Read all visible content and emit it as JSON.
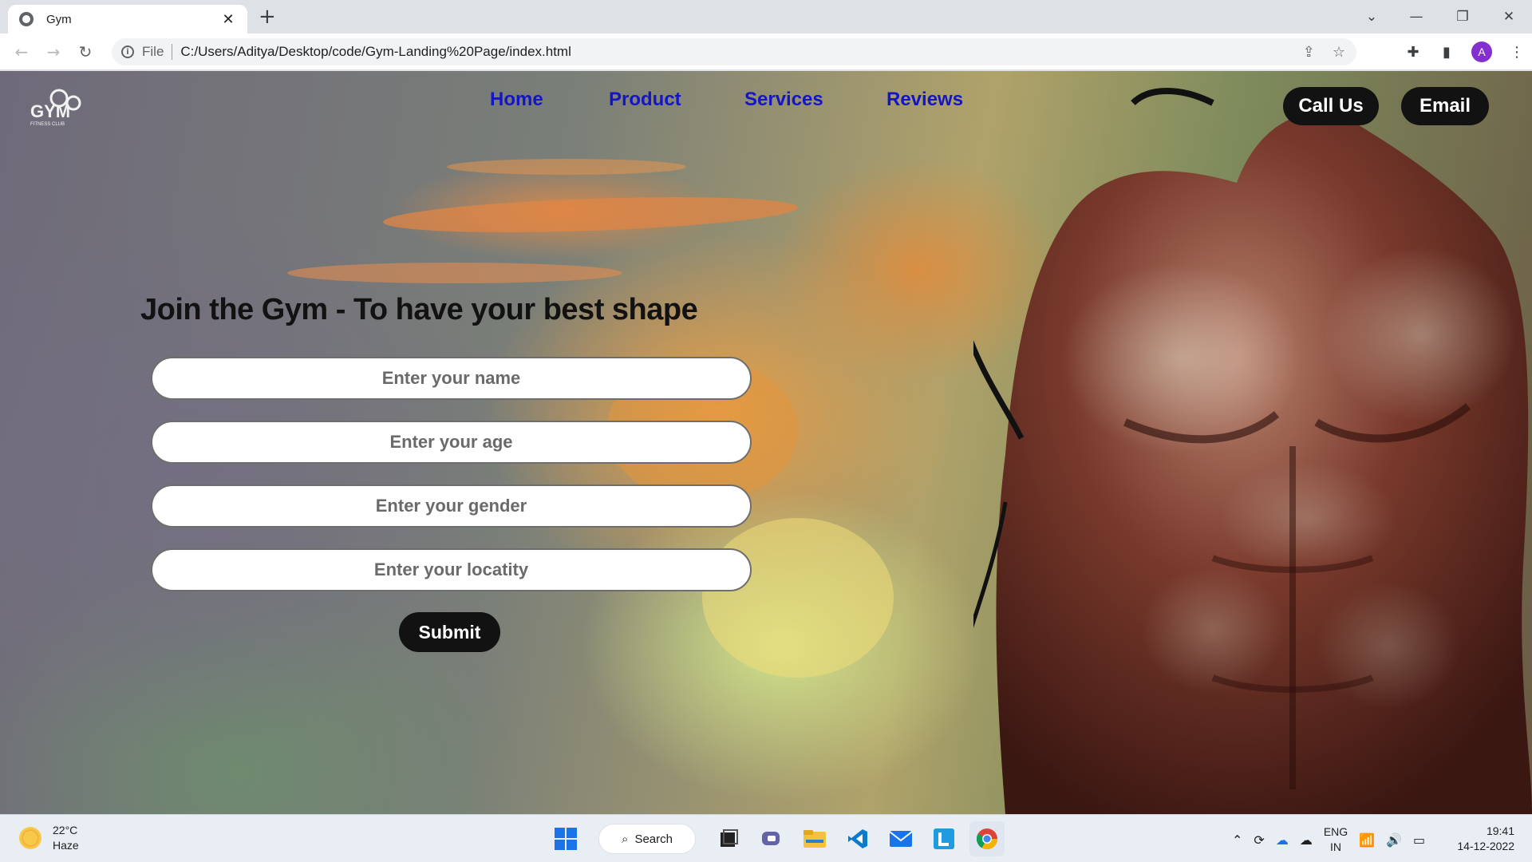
{
  "browser": {
    "tab_title": "Gym",
    "tab_close": "✕",
    "new_tab": "+",
    "url_scheme": "File",
    "url": "C:/Users/Aditya/Desktop/code/Gym-Landing%20Page/index.html",
    "profile_initial": "A"
  },
  "page": {
    "nav": {
      "home": "Home",
      "product": "Product",
      "services": "Services",
      "reviews": "Reviews"
    },
    "call_button": "Call Us",
    "email_button": "Email",
    "headline": "Join the Gym - To have your best shape",
    "form": {
      "name_placeholder": "Enter your name",
      "age_placeholder": "Enter your age",
      "gender_placeholder": "Enter your gender",
      "locality_placeholder": "Enter your locatity",
      "submit_label": "Submit"
    },
    "logo_text": "GYM",
    "logo_subtext": "FITNESS CLUB"
  },
  "taskbar": {
    "temperature": "22°C",
    "weather": "Haze",
    "search_label": "Search",
    "lang_line1": "ENG",
    "lang_line2": "IN",
    "time": "19:41",
    "date": "14-12-2022"
  },
  "colors": {
    "nav_link": "#1515c8",
    "pill_bg": "#121212",
    "headline": "#121212",
    "avatar": "#8430ce"
  }
}
